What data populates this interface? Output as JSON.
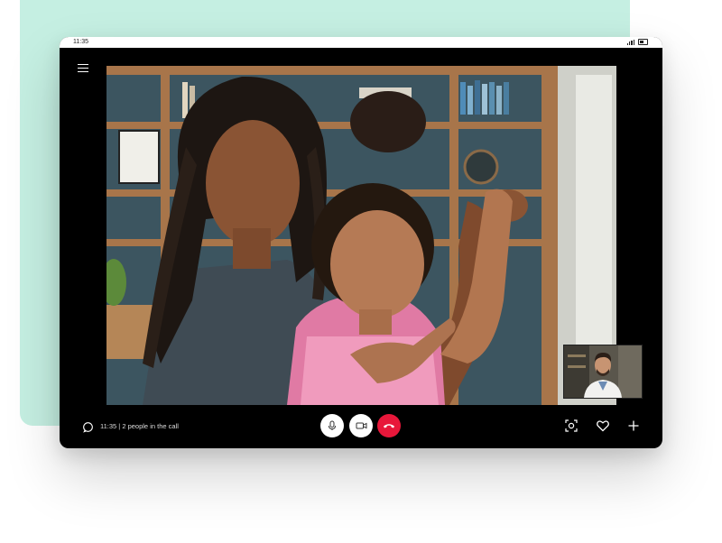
{
  "status_bar": {
    "time": "11:35"
  },
  "call": {
    "info": "11:35 | 2 people in the call"
  },
  "icons": {
    "menu": "hamburger-menu-icon",
    "chat": "chat-bubble-icon",
    "mic": "microphone-icon",
    "camera": "video-camera-icon",
    "end_call": "phone-hangup-icon",
    "focus": "camera-focus-icon",
    "heart": "heart-icon",
    "add": "plus-icon"
  },
  "colors": {
    "background_card": "#c5efe2",
    "device": "#000000",
    "end_call": "#e8173a"
  }
}
